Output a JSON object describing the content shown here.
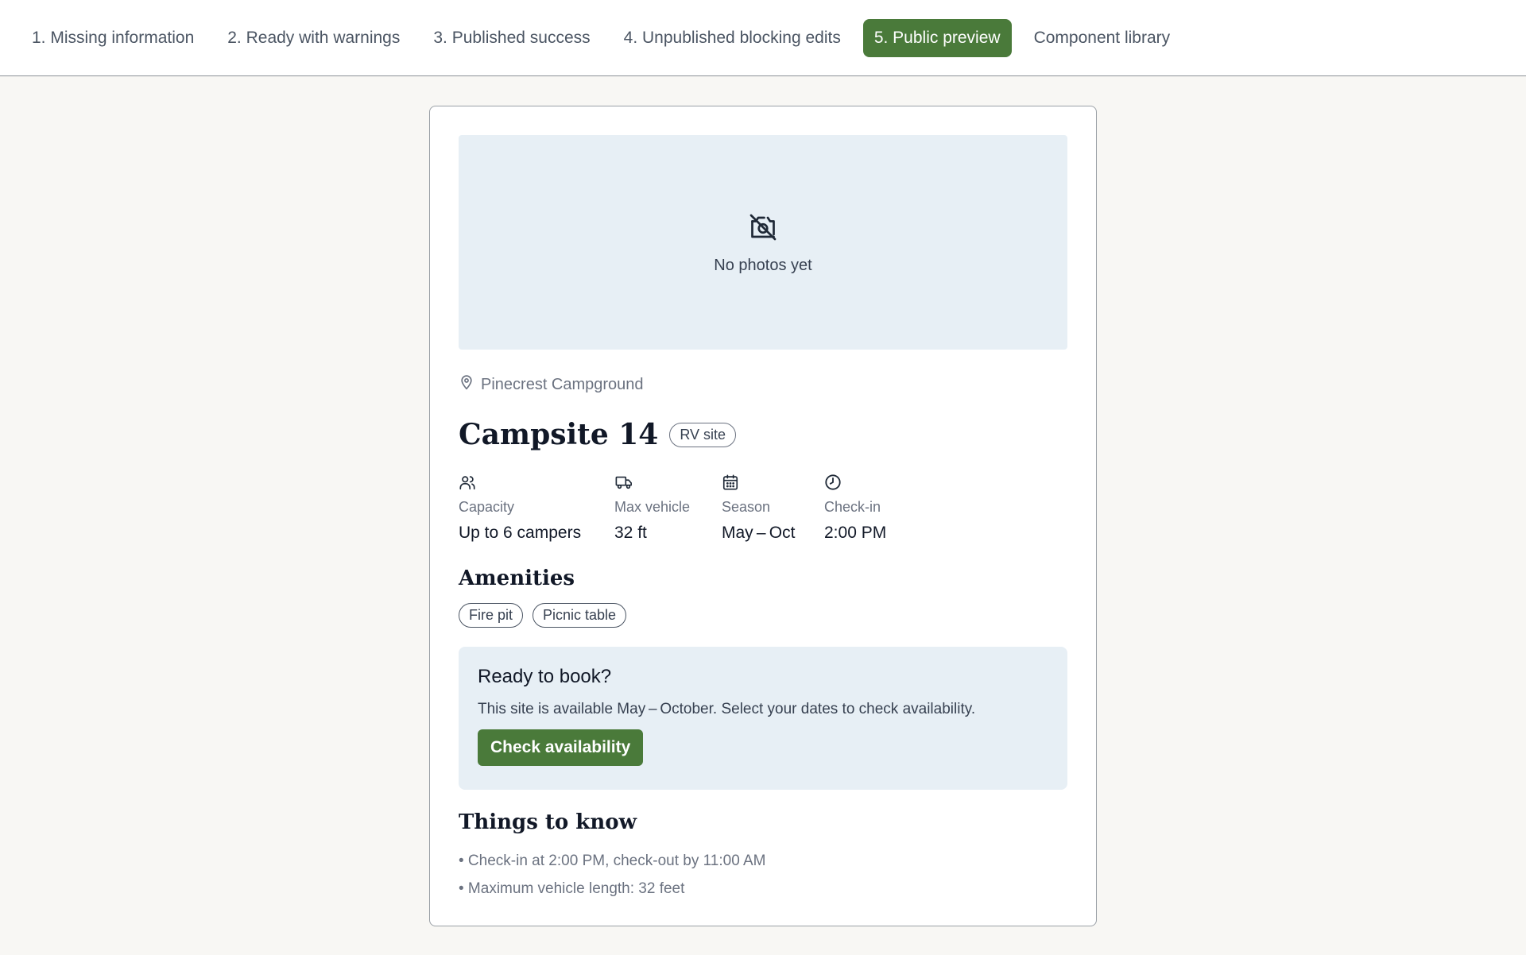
{
  "nav": {
    "tabs": [
      {
        "label": "1. Missing information"
      },
      {
        "label": "2. Ready with warnings"
      },
      {
        "label": "3. Published success"
      },
      {
        "label": "4. Unpublished blocking edits"
      },
      {
        "label": "5. Public preview",
        "active": true
      },
      {
        "label": "Component library"
      }
    ]
  },
  "listing": {
    "photos_empty_text": "No photos yet",
    "photos_icon": "camera-off-icon",
    "location": "Pinecrest Campground",
    "location_icon": "map-pin-icon",
    "title": "Campsite 14",
    "badge": "RV site",
    "facts": [
      {
        "icon": "users-icon",
        "label": "Capacity",
        "value": "Up to 6 campers"
      },
      {
        "icon": "truck-icon",
        "label": "Max vehicle",
        "value": "32 ft"
      },
      {
        "icon": "calendar-icon",
        "label": "Season",
        "value": "May – Oct"
      },
      {
        "icon": "clock-icon",
        "label": "Check-in",
        "value": "2:00 PM"
      }
    ],
    "amenities_heading": "Amenities",
    "amenities": [
      "Fire pit",
      "Picnic table"
    ],
    "booking": {
      "title": "Ready to book?",
      "text": "This site is available May – October. Select your dates to check availability.",
      "button": "Check availability"
    },
    "know_heading": "Things to know",
    "know_items": [
      "• Check-in at 2:00 PM, check-out by 11:00 AM",
      "• Maximum vehicle length: 32 feet"
    ]
  },
  "colors": {
    "accent": "#4a7a3a",
    "panel": "#e7eff5",
    "page_bg": "#f8f7f4"
  }
}
